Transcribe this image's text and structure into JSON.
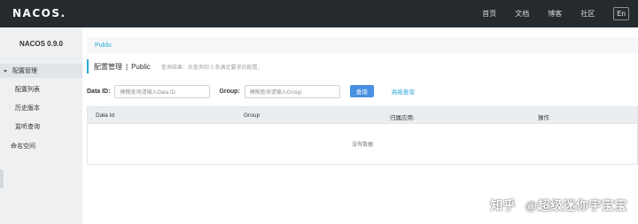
{
  "topbar": {
    "logo_text": "NACOS.",
    "nav": [
      "首页",
      "文档",
      "博客",
      "社区"
    ],
    "lang": "En",
    "bg_color": "#252a2f"
  },
  "sidebar": {
    "version": "NACOS 0.9.0",
    "group_label": "配置管理",
    "items": [
      "配置列表",
      "历史版本",
      "监听查询"
    ],
    "namespace": "命名空间"
  },
  "main": {
    "breadcrumb": "Public",
    "title": "配置管理",
    "title_sep": "|",
    "namespace_title": "Public",
    "hint": "查询结果：共查询到 0 条满足要求的配置。",
    "filters": {
      "dataid_label": "Data ID:",
      "dataid_placeholder": "模糊查询请输入Data ID",
      "group_label": "Group:",
      "group_placeholder": "模糊查询请输入Group",
      "query_button": "查询",
      "advanced_link": "高级查询"
    },
    "table": {
      "columns": [
        "Data Id",
        "Group",
        "归属应用:",
        "操作"
      ],
      "empty_text": "没有数据"
    }
  },
  "watermark": {
    "text1": "知乎",
    "text2": "@超级迷你宇宝宝"
  },
  "colors": {
    "accent": "#2aa7d6",
    "button": "#4a90e2",
    "sidebar_bg": "#eef0f2"
  }
}
